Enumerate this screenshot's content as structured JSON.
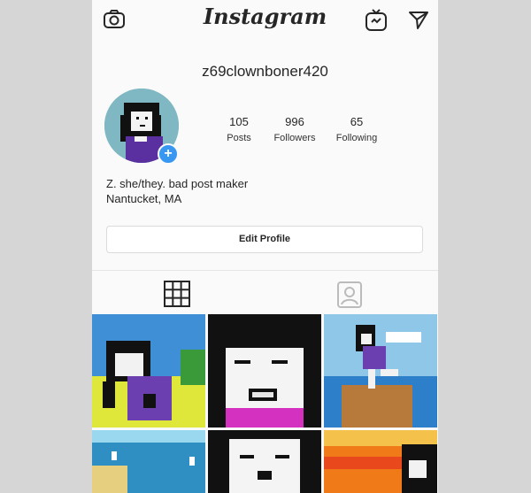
{
  "app": {
    "brand": "Instagram"
  },
  "profile": {
    "username": "z69clownboner420",
    "stats": [
      {
        "value": "105",
        "label": "Posts"
      },
      {
        "value": "996",
        "label": "Followers"
      },
      {
        "value": "65",
        "label": "Following"
      }
    ],
    "bio_line1": "Z. she/they. bad post maker",
    "bio_line2": "Nantucket, MA",
    "edit_button": "Edit Profile"
  },
  "icons": {
    "camera": "camera-icon",
    "igtv": "igtv-icon",
    "direct": "direct-message-icon",
    "grid_tab": "grid-icon",
    "tagged_tab": "tagged-icon",
    "add": "add-story-icon"
  },
  "colors": {
    "accent": "#3897f0",
    "text": "#262626",
    "background": "#fafafa"
  }
}
